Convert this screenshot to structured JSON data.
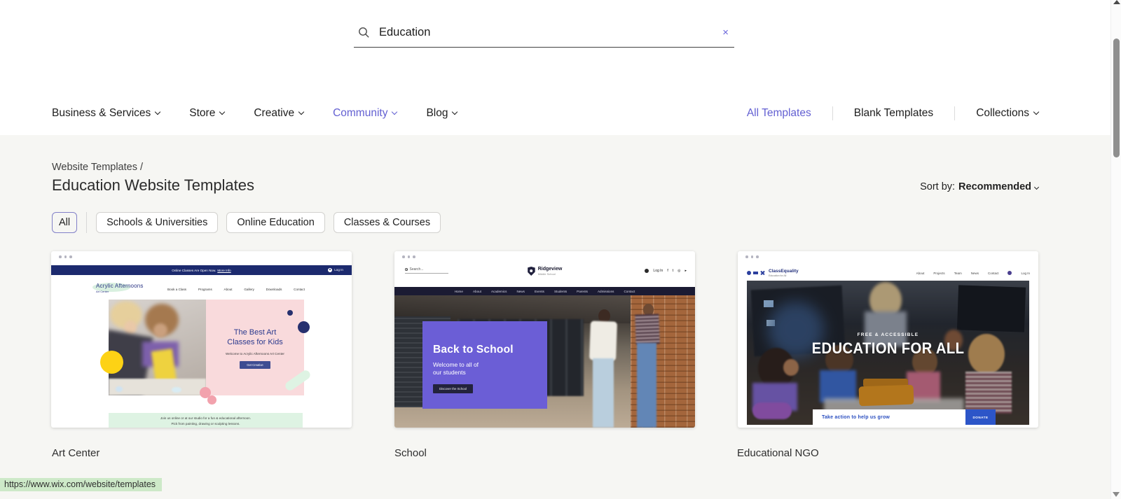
{
  "colors": {
    "accent": "#6360d2",
    "status_bar_bg": "#cde9c8",
    "page_bg": "#f6f6f3"
  },
  "search": {
    "value": "Education",
    "clear_glyph": "×"
  },
  "nav": {
    "left_items": [
      "Business & Services",
      "Store",
      "Creative",
      "Community",
      "Blog"
    ],
    "right_items": [
      "All Templates",
      "Blank Templates",
      "Collections"
    ]
  },
  "page": {
    "breadcrumb": "Website Templates /",
    "title": "Education Website Templates",
    "sort_label": "Sort by:",
    "sort_value": "Recommended"
  },
  "filters": [
    "All",
    "Schools & Universities",
    "Online Education",
    "Classes & Courses"
  ],
  "templates": [
    {
      "name": "Art Center",
      "preview": {
        "announcement": "Online Classes Are Open Now.",
        "announcement_link": "More Info",
        "login": "Log In",
        "logo": "Acrylic Afternoons",
        "logo_sub": "Art Center",
        "nav": [
          "Book a Class",
          "Programs",
          "About",
          "Gallery",
          "Downloads",
          "Contact"
        ],
        "hero_line1": "The Best Art",
        "hero_line2": "Classes for Kids",
        "hero_sub": "Welcome to Acrylic Afternoons Art Center",
        "cta": "Get Creative",
        "banner_line1": "Join us online or at our studio for a fun & educational afternoon.",
        "banner_line2": "Pick from painting, drawing or sculpting lessons."
      }
    },
    {
      "name": "School",
      "preview": {
        "search": "Search...",
        "logo": "Ridgeview",
        "logo_sub": "Middle School",
        "login": "Log In",
        "social_glyphs": [
          "f",
          "t",
          "◎",
          "▸"
        ],
        "nav": [
          "Home",
          "About",
          "Academics",
          "News",
          "Events",
          "Students",
          "Parents",
          "Admissions",
          "Contact"
        ],
        "hero_title": "Back to School",
        "hero_sub1": "Welcome to all of",
        "hero_sub2": "our students",
        "cta": "Discover the School"
      }
    },
    {
      "name": "Educational NGO",
      "preview": {
        "logo": "ClassEquality",
        "logo_sub": "Education for All",
        "nav": [
          "About",
          "Projects",
          "Team",
          "News",
          "Contact"
        ],
        "login": "Log In",
        "kicker": "FREE & ACCESSIBLE",
        "title": "EDUCATION FOR ALL",
        "banner": "Take action to help us grow",
        "cta": "DONATE"
      }
    }
  ],
  "status_bar": {
    "url": "https://www.wix.com/website/templates"
  }
}
